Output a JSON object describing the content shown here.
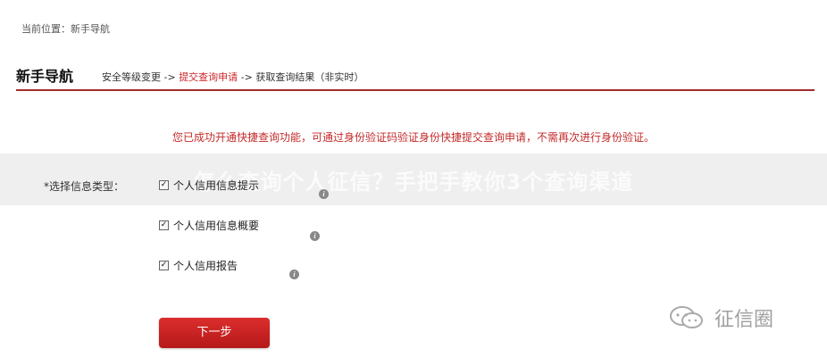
{
  "breadcrumb": {
    "text": "当前位置：新手导航"
  },
  "header": {
    "title": "新手导航",
    "steps": {
      "step1": "安全等级变更",
      "arrow1": " -> ",
      "step2": "提交查询申请",
      "arrow2": " -> ",
      "step3": "获取查询结果（非实时）"
    }
  },
  "notice": {
    "text": "您已成功开通快捷查询功能，可通过身份验证码验证身份快捷提交查询申请，不需再次进行身份验证。"
  },
  "form": {
    "select_label": "*选择信息类型：",
    "options": [
      {
        "label": "个人信用信息提示",
        "checked": true
      },
      {
        "label": "个人信用信息概要",
        "checked": true
      },
      {
        "label": "个人信用报告",
        "checked": true
      }
    ]
  },
  "actions": {
    "next_label": "下一步"
  },
  "watermark": {
    "text": "怎么查询个人征信？手把手教你3个查询渠道"
  },
  "brand": {
    "name": "征信圈"
  },
  "colors": {
    "accent": "#d0262b",
    "divider": "#a32c2c",
    "notice": "#c32b2b"
  }
}
